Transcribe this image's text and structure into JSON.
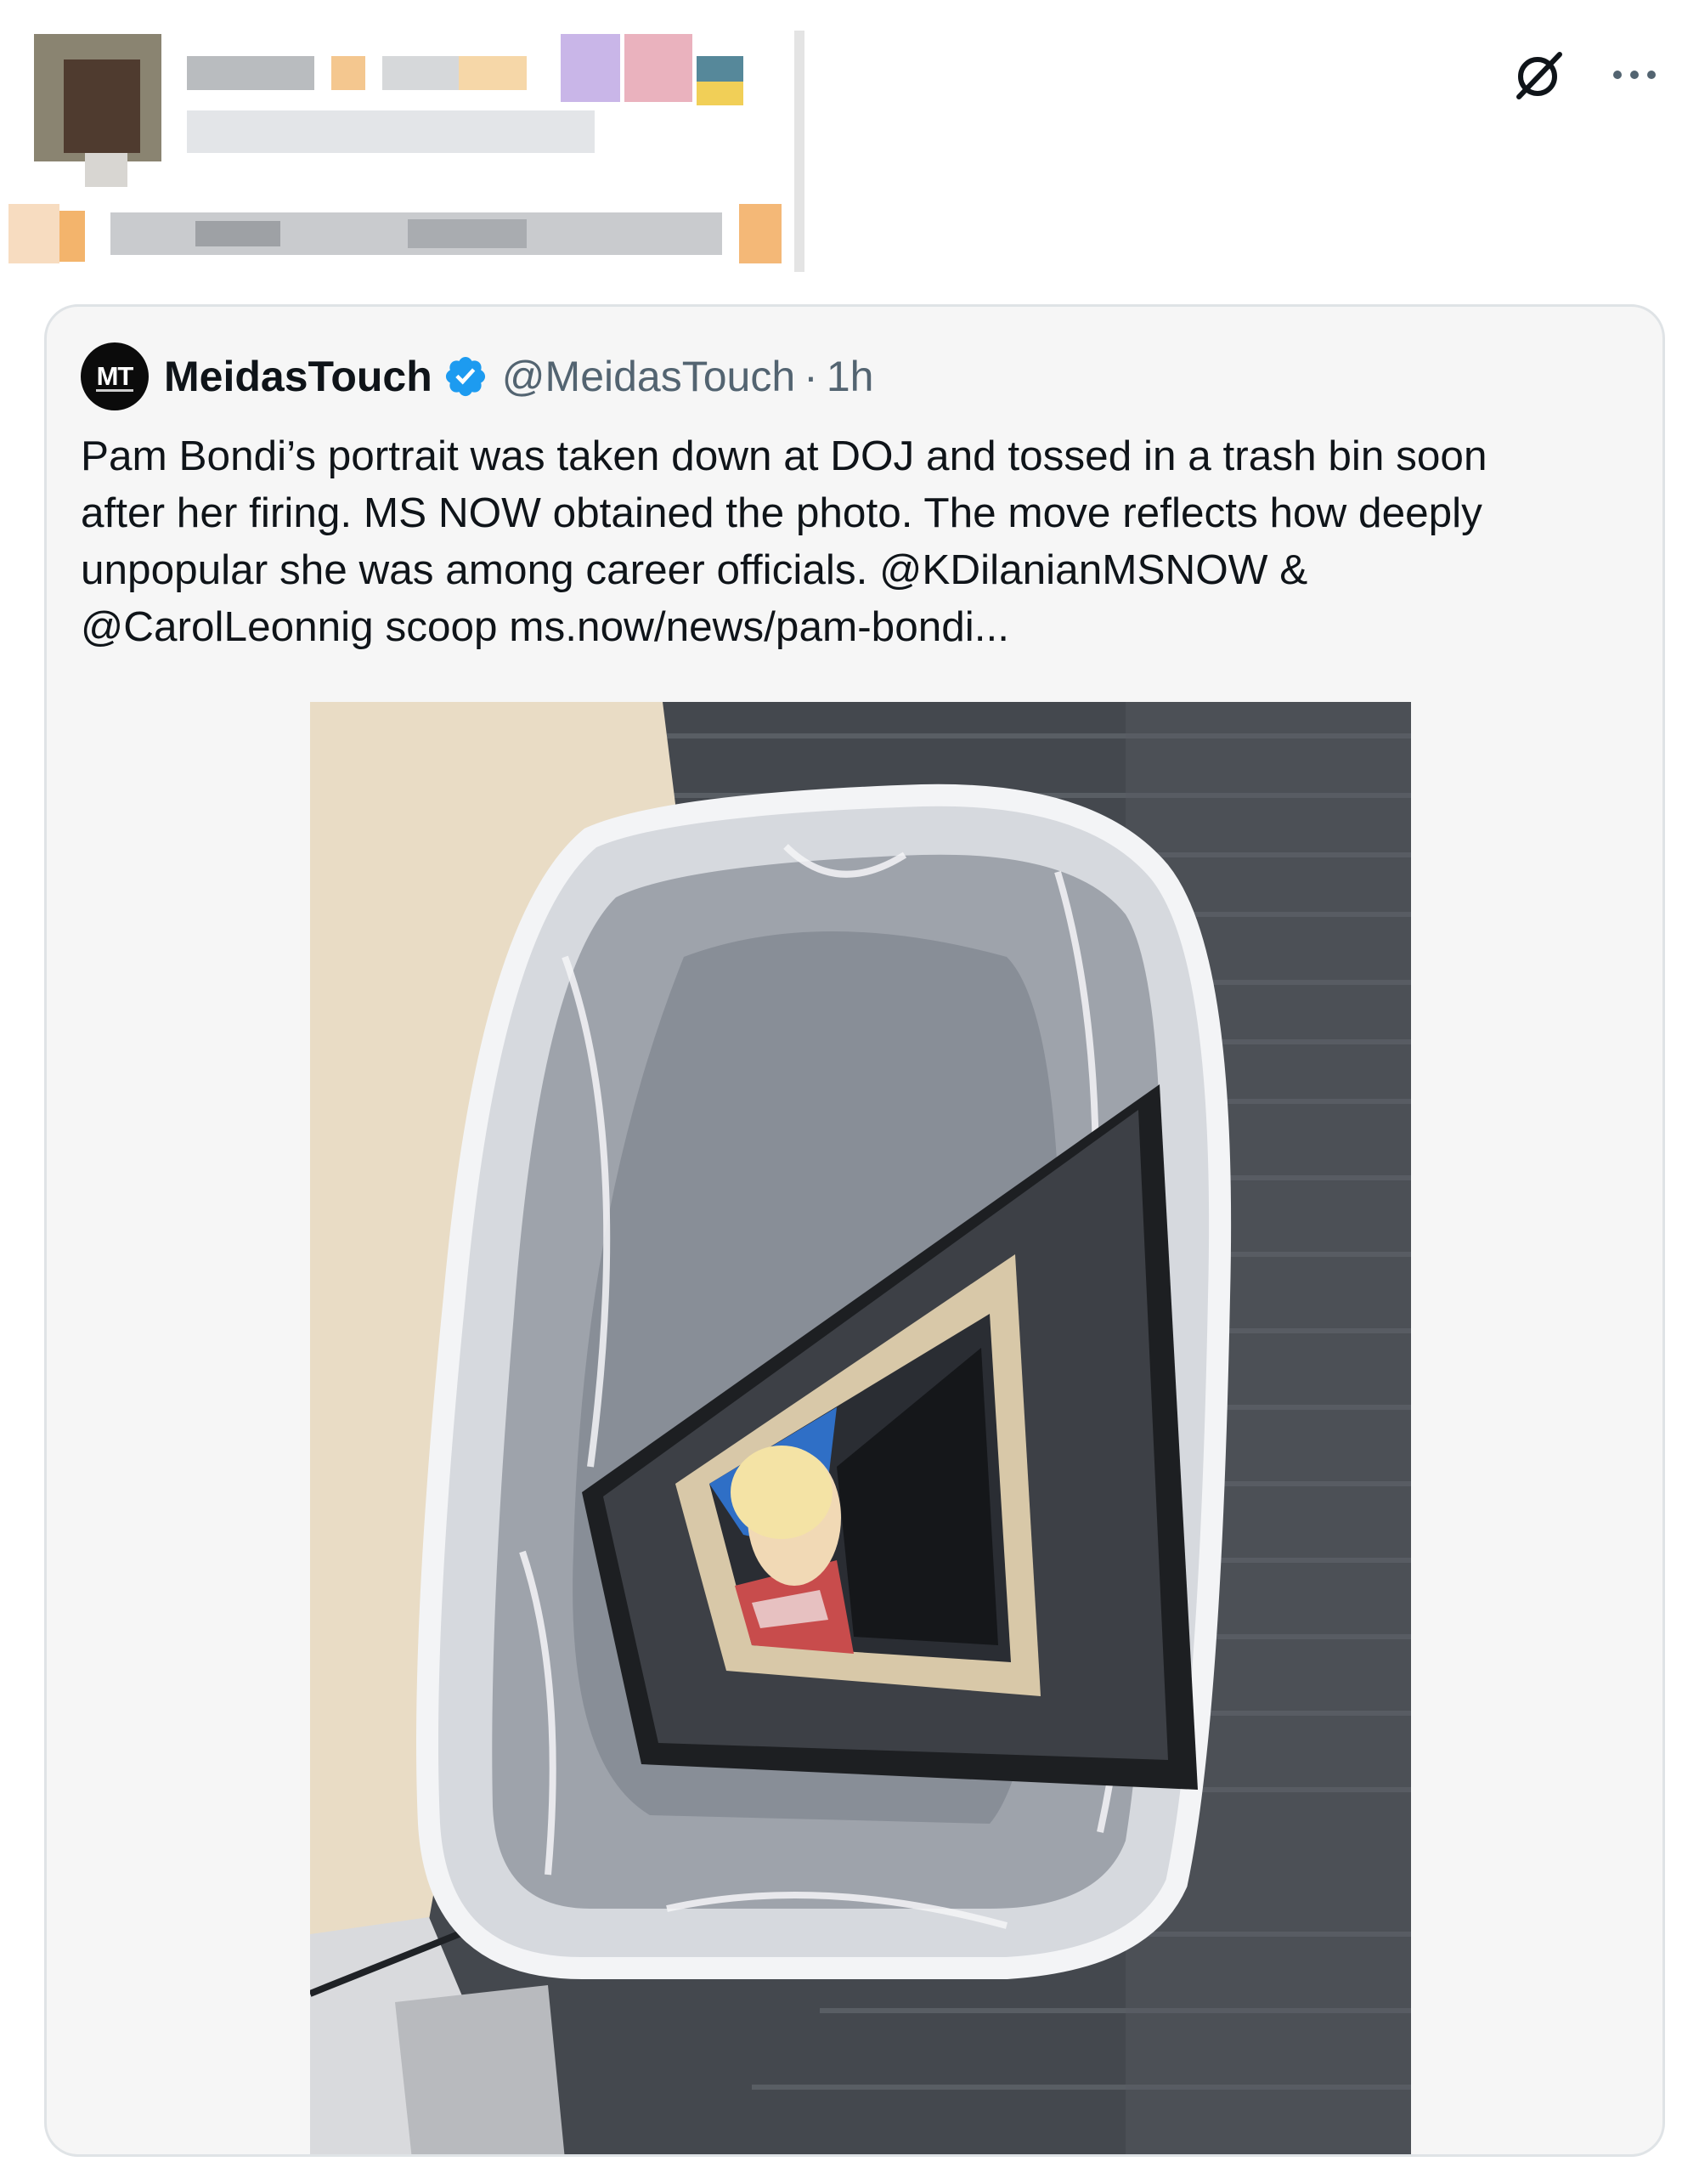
{
  "header": {
    "user_info": "redacted"
  },
  "top_actions": {
    "icons": [
      "grok-icon",
      "more-icon"
    ]
  },
  "quoted_tweet": {
    "display_name": "MeidasTouch",
    "avatar_text": "MT",
    "verified": true,
    "handle": "@MeidasTouch",
    "separator": "·",
    "time": "1h",
    "text_lines": [
      "Pam Bondi’s portrait was taken down at DOJ and tossed in a trash bin soon",
      "after her firing. MS NOW obtained the photo. The move reflects how deeply",
      "unpopular she was among career officials. @KDilanianMSNOW &",
      "@CarolLeonnig scoop ms.now/news/pam-bondi..."
    ],
    "media": {
      "type": "photo"
    }
  },
  "colors": {
    "verified_blue": "#1d9bf0",
    "secondary_text": "#536471",
    "card_border": "#dfe3e6",
    "card_bg": "#f6f6f6"
  }
}
